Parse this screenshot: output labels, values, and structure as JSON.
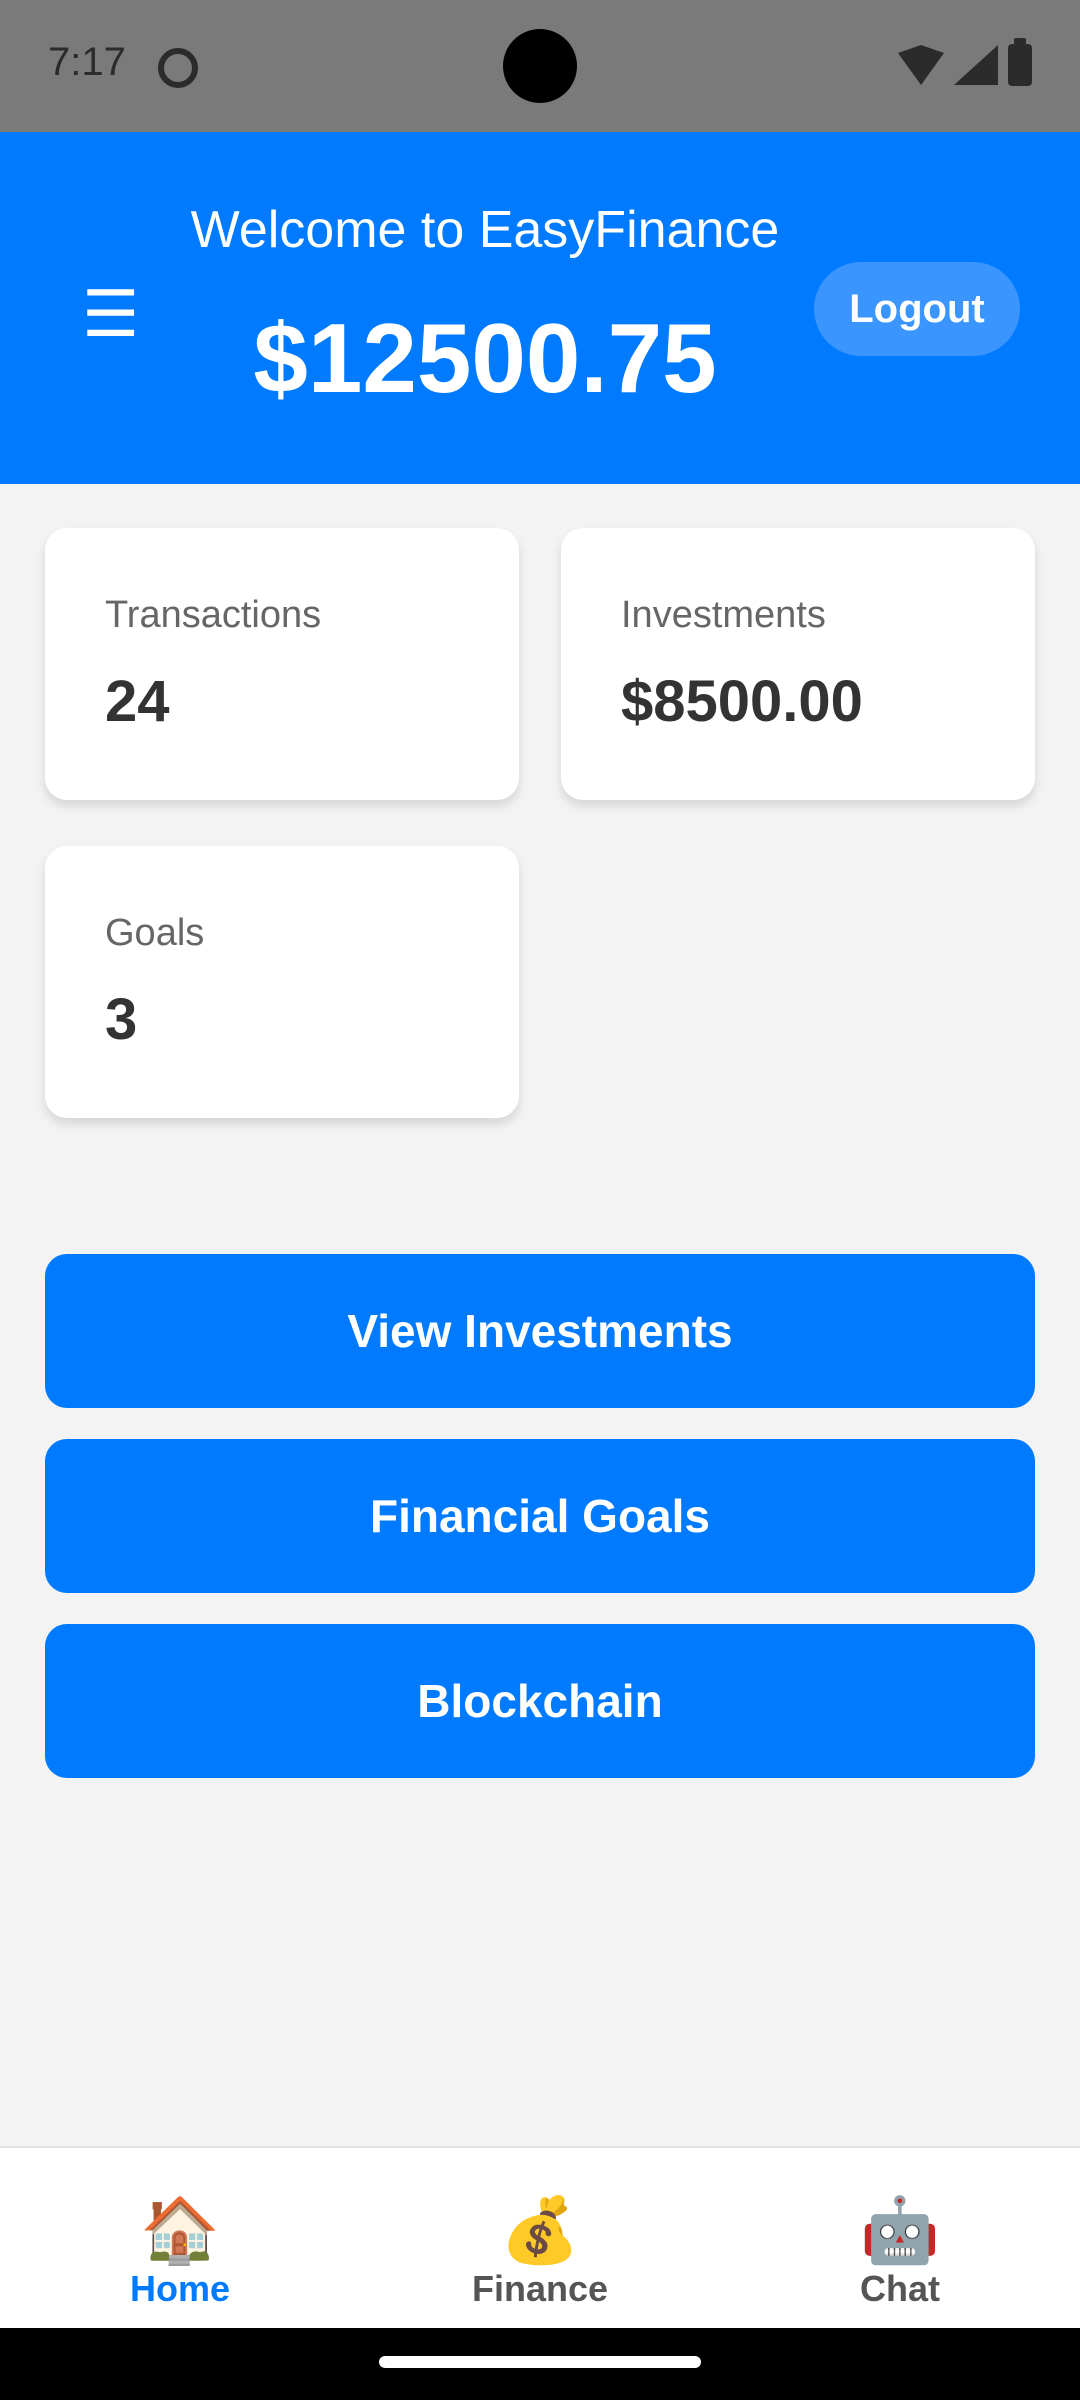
{
  "status_bar": {
    "time": "7:17"
  },
  "header": {
    "welcome": "Welcome to EasyFinance",
    "balance": "$12500.75",
    "menu_icon": "☰",
    "logout_label": "Logout"
  },
  "cards": [
    {
      "label": "Transactions",
      "value": "24"
    },
    {
      "label": "Investments",
      "value": "$8500.00"
    },
    {
      "label": "Goals",
      "value": "3"
    }
  ],
  "actions": [
    {
      "label": "View Investments"
    },
    {
      "label": "Financial Goals"
    },
    {
      "label": "Blockchain"
    }
  ],
  "bottom_nav": {
    "items": [
      {
        "icon": "🏠",
        "label": "Home"
      },
      {
        "icon": "💰",
        "label": "Finance"
      },
      {
        "icon": "🤖",
        "label": "Chat"
      }
    ]
  },
  "colors": {
    "primary": "#007aff",
    "header_bg": "#007aff",
    "logout_bg": "#3a95ff",
    "page_bg": "#f3f3f3"
  }
}
